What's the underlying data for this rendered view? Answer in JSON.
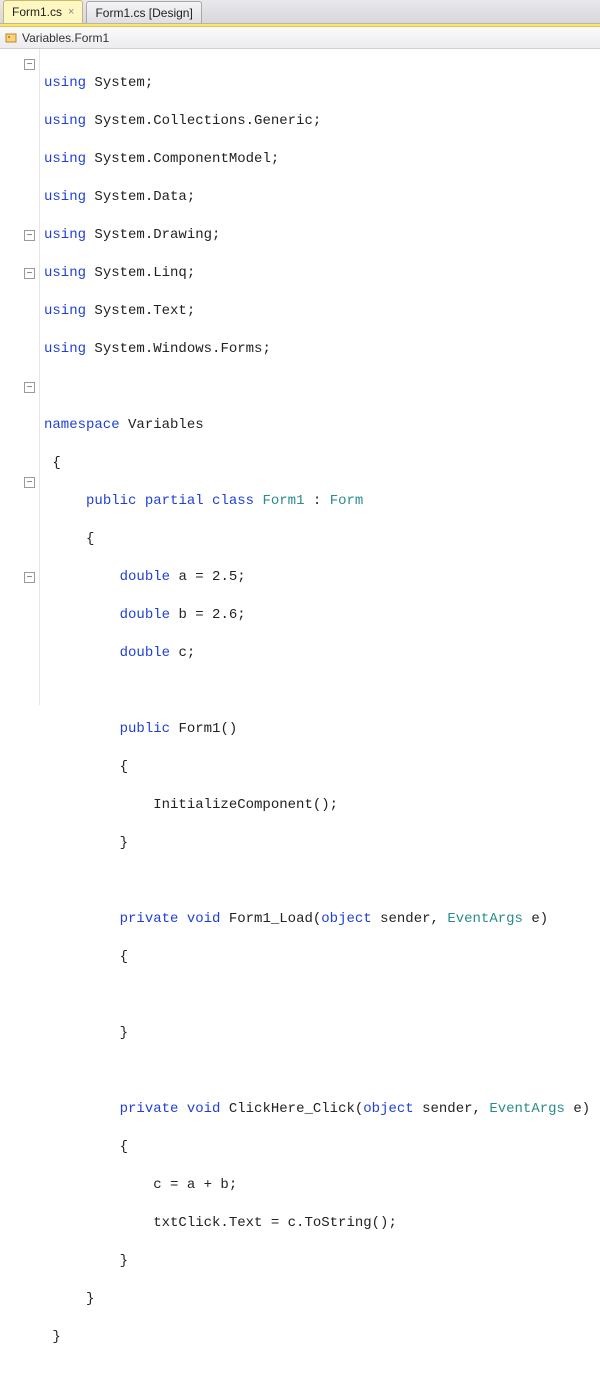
{
  "tabs": [
    {
      "label": "Form1.cs",
      "active": true
    },
    {
      "label": "Form1.cs [Design]",
      "active": false
    }
  ],
  "breadcrumb": "Variables.Form1",
  "gutter": {
    "fold_minus": "−",
    "lines": [
      "fold",
      "",
      "",
      "",
      "",
      "",
      "",
      "",
      "",
      "fold",
      "",
      "fold",
      "",
      "",
      "",
      "",
      "",
      "fold",
      "",
      "",
      "",
      "",
      "fold",
      "",
      "",
      "",
      "",
      "fold",
      "",
      "",
      "",
      "",
      "",
      "",
      ""
    ]
  },
  "code": {
    "l1": {
      "kw": "using",
      "rest": " System;"
    },
    "l2": {
      "kw": "using",
      "rest": " System.Collections.Generic;"
    },
    "l3": {
      "kw": "using",
      "rest": " System.ComponentModel;"
    },
    "l4": {
      "kw": "using",
      "rest": " System.Data;"
    },
    "l5": {
      "kw": "using",
      "rest": " System.Drawing;"
    },
    "l6": {
      "kw": "using",
      "rest": " System.Linq;"
    },
    "l7": {
      "kw": "using",
      "rest": " System.Text;"
    },
    "l8": {
      "kw": "using",
      "rest": " System.Windows.Forms;"
    },
    "blank": "",
    "l10": {
      "kw": "namespace",
      "rest": " Variables"
    },
    "l11": " {",
    "l12": {
      "pre": "     ",
      "kw1": "public",
      "kw2": " partial",
      "kw3": " class",
      "type1": " Form1",
      "mid": " : ",
      "type2": "Form"
    },
    "l13": "     {",
    "l14": {
      "pre": "         ",
      "kw": "double",
      "rest": " a = 2.5;"
    },
    "l15": {
      "pre": "         ",
      "kw": "double",
      "rest": " b = 2.6;"
    },
    "l16": {
      "pre": "         ",
      "kw": "double",
      "rest": " c;"
    },
    "l18": {
      "pre": "         ",
      "kw": "public",
      "rest": " Form1()"
    },
    "l19": "         {",
    "l20": "             InitializeComponent();",
    "l21": "         }",
    "l23": {
      "pre": "         ",
      "kw1": "private",
      "kw2": " void",
      "mid": " Form1_Load(",
      "kw3": "object",
      "mid2": " sender, ",
      "type": "EventArgs",
      "rest": " e)"
    },
    "l24": "         {",
    "l26": "         }",
    "l28": {
      "pre": "         ",
      "kw1": "private",
      "kw2": " void",
      "mid": " ClickHere_Click(",
      "kw3": "object",
      "mid2": " sender, ",
      "type": "EventArgs",
      "rest": " e)"
    },
    "l29": "         {",
    "l30": "             c = a + b;",
    "l31": "             txtClick.Text = c.ToString();",
    "l32": "         }",
    "l33": "     }",
    "l34": " }"
  }
}
